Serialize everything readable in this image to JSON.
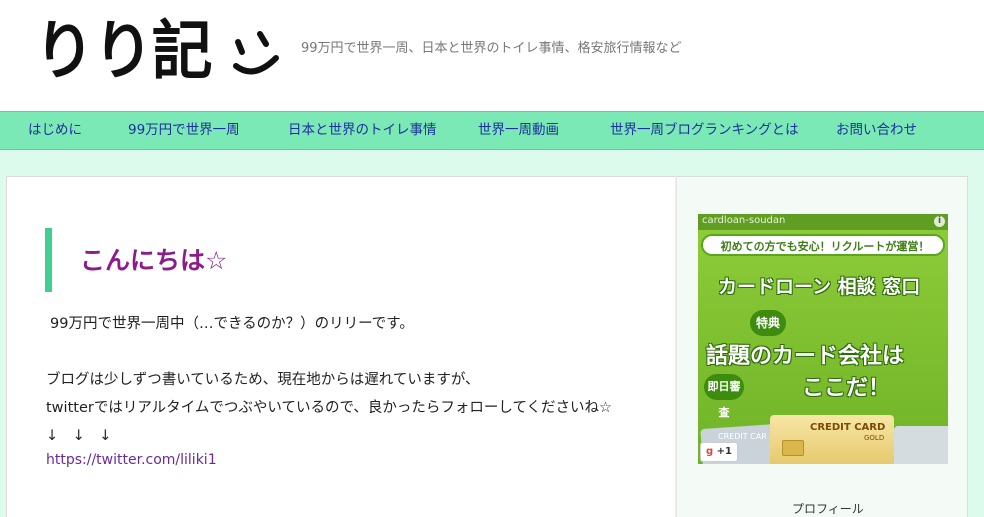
{
  "header": {
    "logo_text": "りり記",
    "tagline": "99万円で世界一周、日本と世界のトイレ事情、格安旅行情報など"
  },
  "nav": {
    "items": [
      {
        "label": "はじめに"
      },
      {
        "label": "99万円で世界一周"
      },
      {
        "label": "日本と世界のトイレ事情"
      },
      {
        "label": "世界一周動画"
      },
      {
        "label": "世界一周ブログランキングとは"
      },
      {
        "label": "お問い合わせ"
      }
    ]
  },
  "post": {
    "title": "こんにちは☆",
    "para1": "99万円で世界一周中（…できるのか？）のリリーです。",
    "para2": "ブログは少しずつ書いているため、現在地からは遅れていますが、",
    "para3": "twitterではリアルタイムでつぶやいているので、良かったらフォローしてくださいね☆",
    "arrows": "↓　↓　↓",
    "link": "https://twitter.com/liliki1"
  },
  "ad": {
    "source": "cardloan-soudan",
    "info_icon": "i",
    "ribbon": "初めての方でも安心！リクルートが運営！",
    "headline": "カードローン 相談 窓口",
    "badge_special": "特典",
    "main_line": "話題のカード会社は",
    "badge_same_day": "即日審査",
    "second_line": "ここだ！",
    "card_silver_label": "CREDIT CAR",
    "card_gold_label": "CREDIT CARD",
    "card_gold_sub": "GOLD",
    "plus_one_g": "g",
    "plus_one_text": "+1"
  },
  "sidebar": {
    "partial_heading": "プロフィール"
  }
}
